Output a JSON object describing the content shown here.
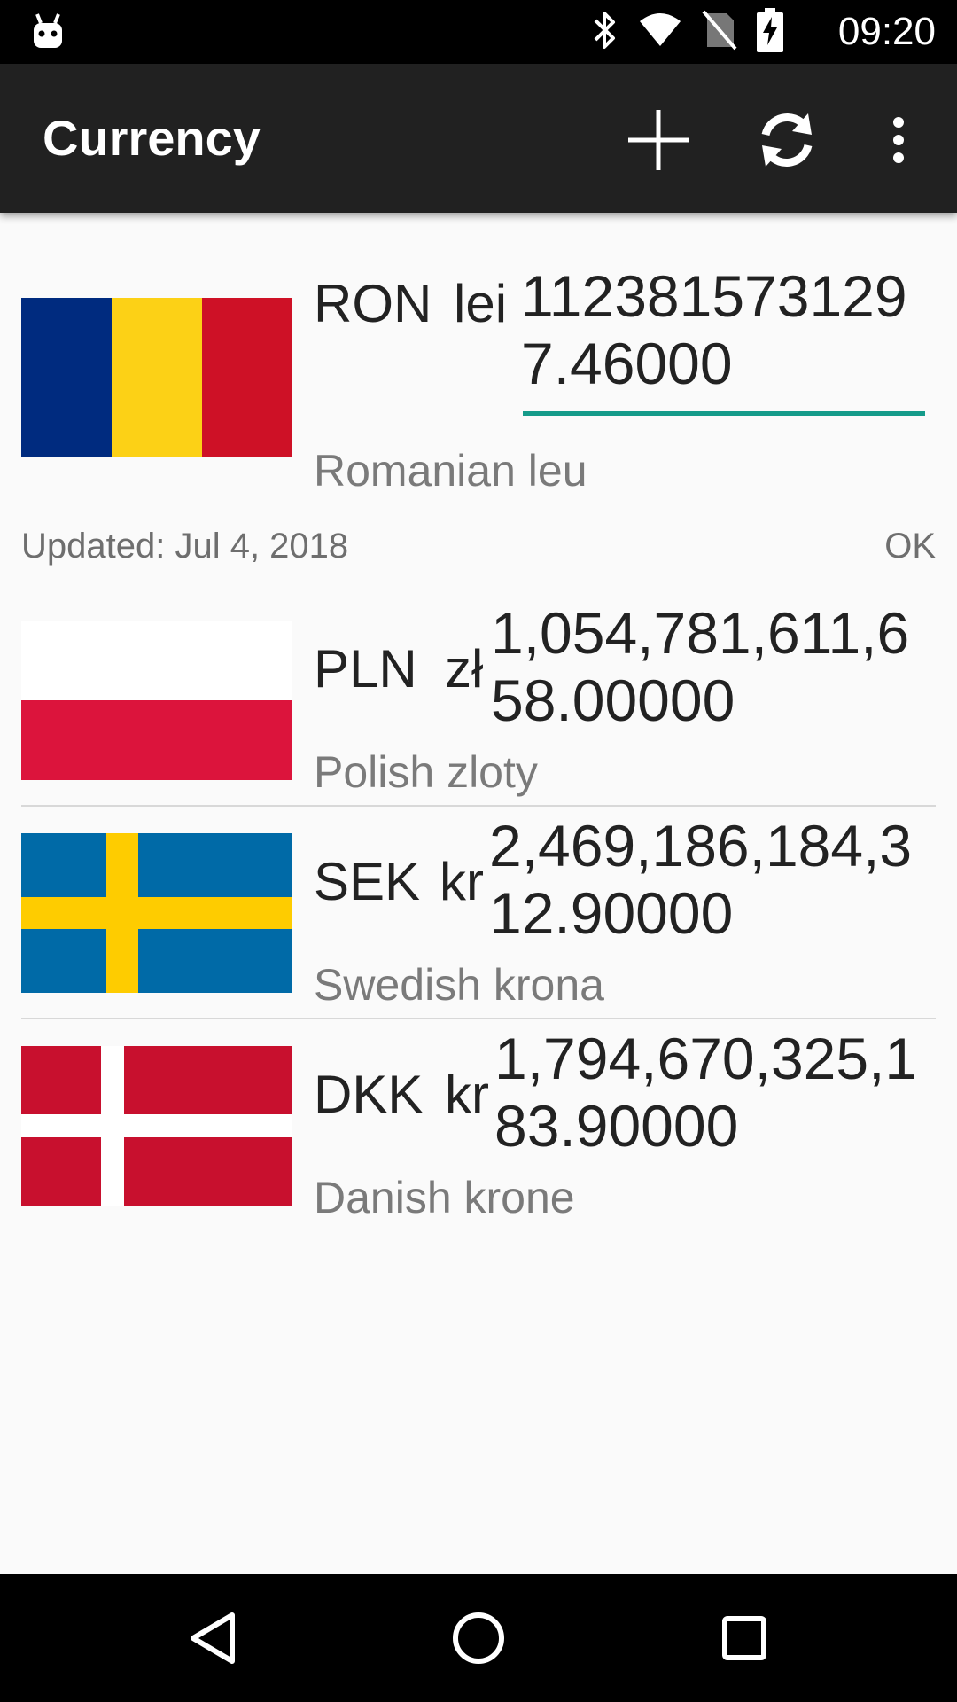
{
  "status_bar": {
    "time": "09:20",
    "icons": [
      "android-icon",
      "bluetooth-icon",
      "wifi-icon",
      "no-sim-icon",
      "battery-charging-icon"
    ]
  },
  "app_bar": {
    "title": "Currency",
    "actions": [
      "add-icon",
      "refresh-icon",
      "overflow-menu-icon"
    ]
  },
  "base": {
    "code": "RON",
    "symbol": "lei",
    "value": "1123815731297.46000",
    "name": "Romanian leu",
    "accent_color": "#159b8a"
  },
  "updated_text": "Updated: Jul 4, 2018",
  "status_text": "OK",
  "rows": [
    {
      "code": "PLN",
      "symbol": "zł",
      "value": "1,054,781,611,658.00000",
      "name": "Polish zloty"
    },
    {
      "code": "SEK",
      "symbol": "kr",
      "value": "2,469,186,184,312.90000",
      "name": "Swedish krona"
    },
    {
      "code": "DKK",
      "symbol": "kr",
      "value": "1,794,670,325,183.90000",
      "name": "Danish krone"
    }
  ],
  "nav_bar": [
    "back-icon",
    "home-icon",
    "recents-icon"
  ]
}
